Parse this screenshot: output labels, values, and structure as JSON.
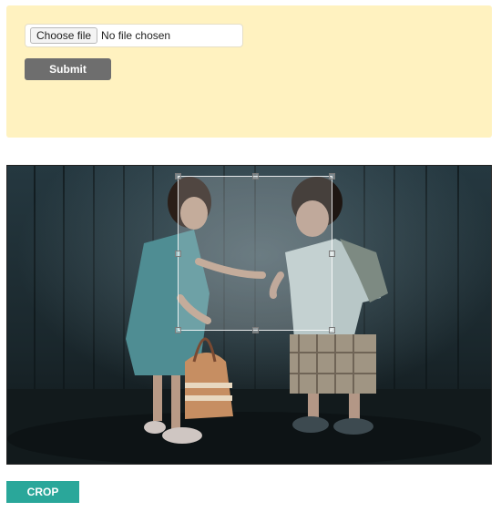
{
  "upload_form": {
    "choose_file_label": "Choose file",
    "file_status": "No file chosen",
    "submit_label": "Submit"
  },
  "cropper": {
    "image_description": "two children in a dark wooden setting"
  },
  "actions": {
    "crop_label": "CROP"
  },
  "colors": {
    "panel_background": "#fff2c0",
    "submit_button": "#6e6e6e",
    "crop_button": "#2aa79a"
  }
}
